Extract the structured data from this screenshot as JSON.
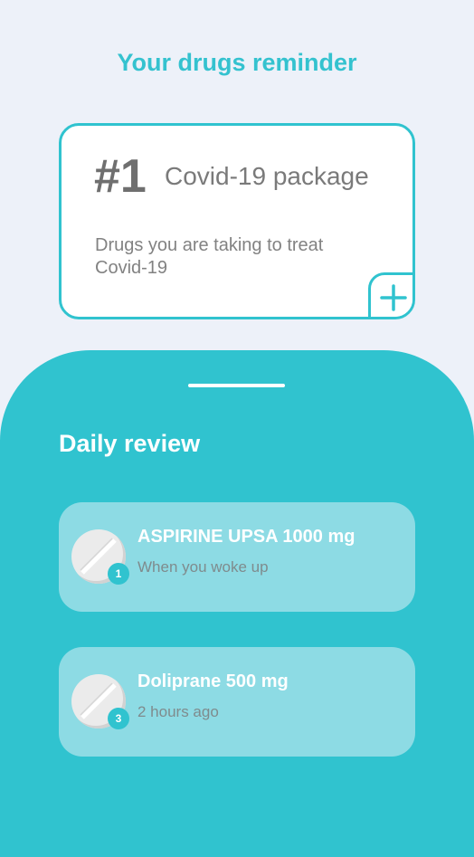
{
  "header": {
    "title": "Your drugs reminder"
  },
  "package": {
    "number": "#1",
    "title": "Covid-19 package",
    "description": "Drugs you are taking to treat Covid-19",
    "add_label": "+"
  },
  "review": {
    "title": "Daily review",
    "items": [
      {
        "name": "ASPIRINE UPSA 1000 mg",
        "time": "When you woke up",
        "badge": "1"
      },
      {
        "name": "Doliprane 500 mg",
        "time": "2 hours ago",
        "badge": "3"
      }
    ]
  },
  "colors": {
    "accent": "#30c3cf",
    "background": "#edf1f9",
    "card_light": "#8ddbe4"
  }
}
